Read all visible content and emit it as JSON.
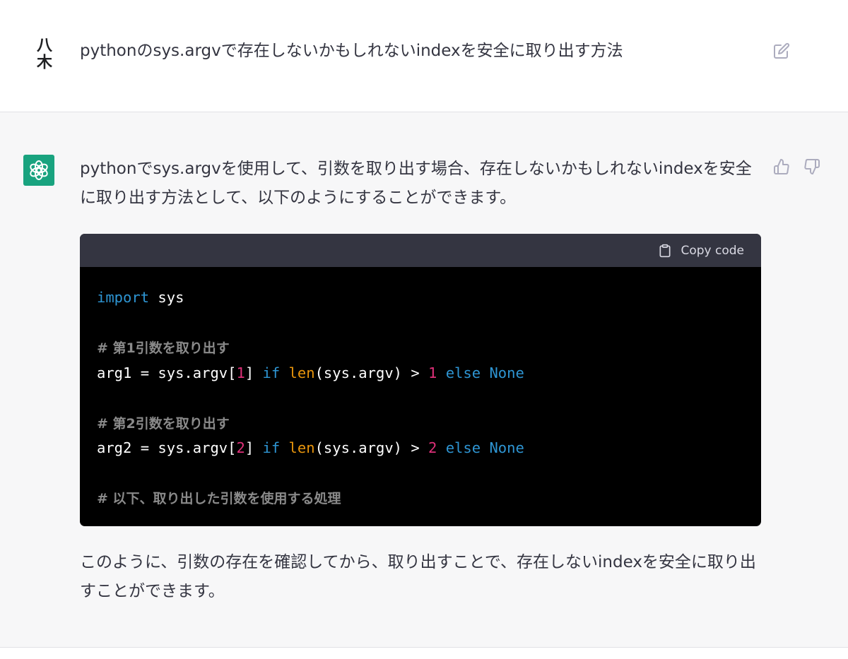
{
  "user_message": {
    "avatar_text": "八木",
    "text": "pythonのsys.argvで存在しないかもしれないindexを安全に取り出す方法"
  },
  "assistant_message": {
    "intro": "pythonでsys.argvを使用して、引数を取り出す場合、存在しないかもしれないindexを安全に取り出す方法として、以下のようにすることができます。",
    "copy_label": "Copy code",
    "code": {
      "line1": {
        "kw": "import",
        "rest": " sys"
      },
      "comment1": "# 第1引数を取り出す",
      "line2": {
        "a": "arg1 = sys.argv[",
        "n1": "1",
        "b": "] ",
        "if": "if",
        "sp": " ",
        "len": "len",
        "c": "(sys.argv) > ",
        "n2": "1",
        "sp2": " ",
        "else": "else",
        "sp3": " ",
        "none": "None"
      },
      "comment2": "# 第2引数を取り出す",
      "line3": {
        "a": "arg2 = sys.argv[",
        "n1": "2",
        "b": "] ",
        "if": "if",
        "sp": " ",
        "len": "len",
        "c": "(sys.argv) > ",
        "n2": "2",
        "sp2": " ",
        "else": "else",
        "sp3": " ",
        "none": "None"
      },
      "comment3": "# 以下、取り出した引数を使用する処理"
    },
    "outro": "このように、引数の存在を確認してから、取り出すことで、存在しないindexを安全に取り出すことができます。"
  },
  "colors": {
    "assistant_bg": "#f7f7f8",
    "avatar_green": "#19a37f",
    "code_header": "#343541",
    "keyword": "#2e95d3",
    "number": "#df3079",
    "builtin": "#e9950c"
  },
  "icons": [
    "edit-icon",
    "openai-logo-icon",
    "thumbs-up-icon",
    "thumbs-down-icon",
    "clipboard-icon"
  ]
}
